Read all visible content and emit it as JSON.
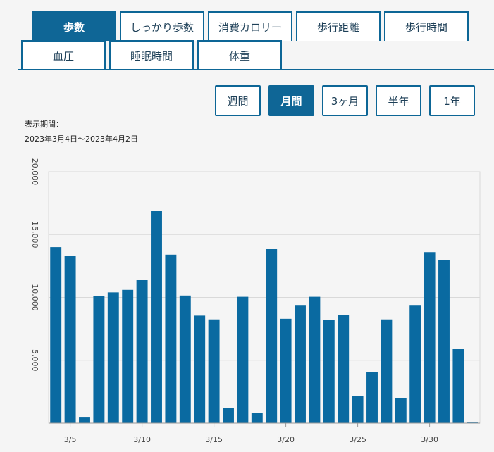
{
  "tabs": {
    "row1": [
      "歩数",
      "しっかり歩数",
      "消費カロリー",
      "歩行距離",
      "歩行時間"
    ],
    "row2": [
      "血圧",
      "睡眠時間",
      "体重"
    ],
    "active": "歩数"
  },
  "periods": {
    "buttons": [
      "週間",
      "月間",
      "3ヶ月",
      "半年",
      "1年"
    ],
    "active": "月間"
  },
  "display_period": {
    "label": "表示期間：",
    "range": "2023年3月4日〜2023年4月2日"
  },
  "colors": {
    "accent": "#0f6696",
    "bar": "#0a6aa1",
    "grid": "#d9d9d9"
  },
  "chart_data": {
    "type": "bar",
    "title": "",
    "xlabel": "",
    "ylabel": "",
    "ylim": [
      0,
      20000
    ],
    "yticks": [
      5000,
      10000,
      15000,
      20000
    ],
    "ytick_labels": [
      "5,000",
      "10,000",
      "15,000",
      "20,000"
    ],
    "categories": [
      "3/4",
      "3/5",
      "3/6",
      "3/7",
      "3/8",
      "3/9",
      "3/10",
      "3/11",
      "3/12",
      "3/13",
      "3/14",
      "3/15",
      "3/16",
      "3/17",
      "3/18",
      "3/19",
      "3/20",
      "3/21",
      "3/22",
      "3/23",
      "3/24",
      "3/25",
      "3/26",
      "3/27",
      "3/28",
      "3/29",
      "3/30",
      "3/31",
      "4/1",
      "4/2"
    ],
    "x_tick_labels": [
      "3/5",
      "3/10",
      "3/15",
      "3/20",
      "3/25",
      "3/30"
    ],
    "values": [
      14000,
      13300,
      500,
      10100,
      10400,
      10600,
      11400,
      16900,
      13400,
      10150,
      8550,
      8250,
      1200,
      10050,
      800,
      13850,
      8300,
      9400,
      10050,
      8200,
      8600,
      2150,
      4050,
      8250,
      2000,
      9400,
      13600,
      12950,
      5900,
      50
    ],
    "grid": true
  }
}
